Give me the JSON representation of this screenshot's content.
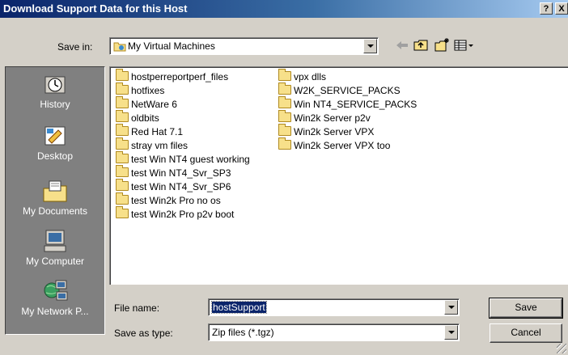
{
  "window": {
    "title": "Download Support Data for this Host",
    "help_label": "?",
    "close_label": "X"
  },
  "save_in": {
    "label": "Save in:",
    "value": "My Virtual Machines",
    "icon": "folder-icon"
  },
  "toolbar": {
    "icons": [
      "back-arrow-icon",
      "up-folder-icon",
      "new-folder-icon",
      "view-menu-icon"
    ]
  },
  "places": {
    "items": [
      {
        "label": "History",
        "icon": "history-icon"
      },
      {
        "label": "Desktop",
        "icon": "desktop-icon"
      },
      {
        "label": "My Documents",
        "icon": "my-documents-icon"
      },
      {
        "label": "My Computer",
        "icon": "my-computer-icon"
      },
      {
        "label": "My Network P...",
        "icon": "network-icon"
      }
    ]
  },
  "files": {
    "column1": [
      "hostperreportperf_files",
      "hotfixes",
      "NetWare 6",
      "oldbits",
      "Red Hat 7.1",
      "stray vm files",
      "test Win NT4 guest working",
      "test Win NT4_Svr_SP3",
      "test Win NT4_Svr_SP6",
      "test Win2k Pro no os",
      "test Win2k Pro p2v boot"
    ],
    "column2": [
      "vpx dlls",
      "W2K_SERVICE_PACKS",
      "Win NT4_SERVICE_PACKS",
      "Win2k Server p2v",
      "Win2k Server VPX",
      "Win2k Server VPX too"
    ]
  },
  "file_name": {
    "label": "File name:",
    "value": "hostSupport"
  },
  "save_as_type": {
    "label": "Save as type:",
    "value": "Zip files (*.tgz)"
  },
  "buttons": {
    "save": "Save",
    "cancel": "Cancel"
  }
}
